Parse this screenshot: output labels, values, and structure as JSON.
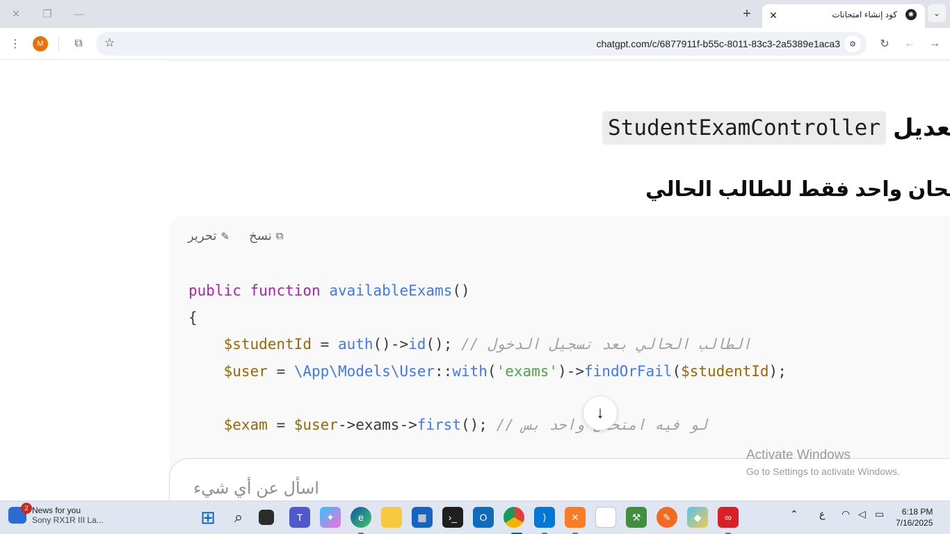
{
  "browser": {
    "tab_title": "كود إنشاء امتحانات",
    "new_tab_icon": "+",
    "url": "chatgpt.com/c/6877911f-b55c-8011-83c3-2a5389e1aca3",
    "profile_initial": "M"
  },
  "page": {
    "heading_code": "StudentExamController",
    "heading_text": "تعديل",
    "subheading": "امتحان واحد فقط للطالب الحالي",
    "code_actions": {
      "copy": "نسخ",
      "edit": "تحرير"
    },
    "code_lines": [
      "public function availableExams()",
      "{",
      "    $studentId = auth()->id(); // الطالب الحالي بعد تسجيل الدخول",
      "    $user = \\App\\Models\\User::with('exams')->findOrFail($studentId);",
      "",
      "    $exam = $user->exams->first(); // لو فيه امتحان واحد بس"
    ],
    "composer_placeholder": "اسأل عن أي شيء"
  },
  "watermark": {
    "line1": "Activate Windows",
    "line2": "Go to Settings to activate Windows."
  },
  "taskbar": {
    "news_badge": "2",
    "news_title": "News for you",
    "news_subtitle": "Sony RX1R III La...",
    "input_lang": "ع",
    "time": "6:18 PM",
    "date": "7/16/2025",
    "apps": [
      "start-icon",
      "search-icon",
      "task-view-icon",
      "teams-icon",
      "copilot-icon",
      "edge-icon",
      "file-explorer-icon",
      "store-icon",
      "terminal-icon",
      "outlook-icon",
      "chrome-icon",
      "vscode-icon",
      "xampp-icon",
      "notepad-icon",
      "tool-icon",
      "app-icon",
      "git-icon",
      "creative-cloud-icon"
    ]
  }
}
